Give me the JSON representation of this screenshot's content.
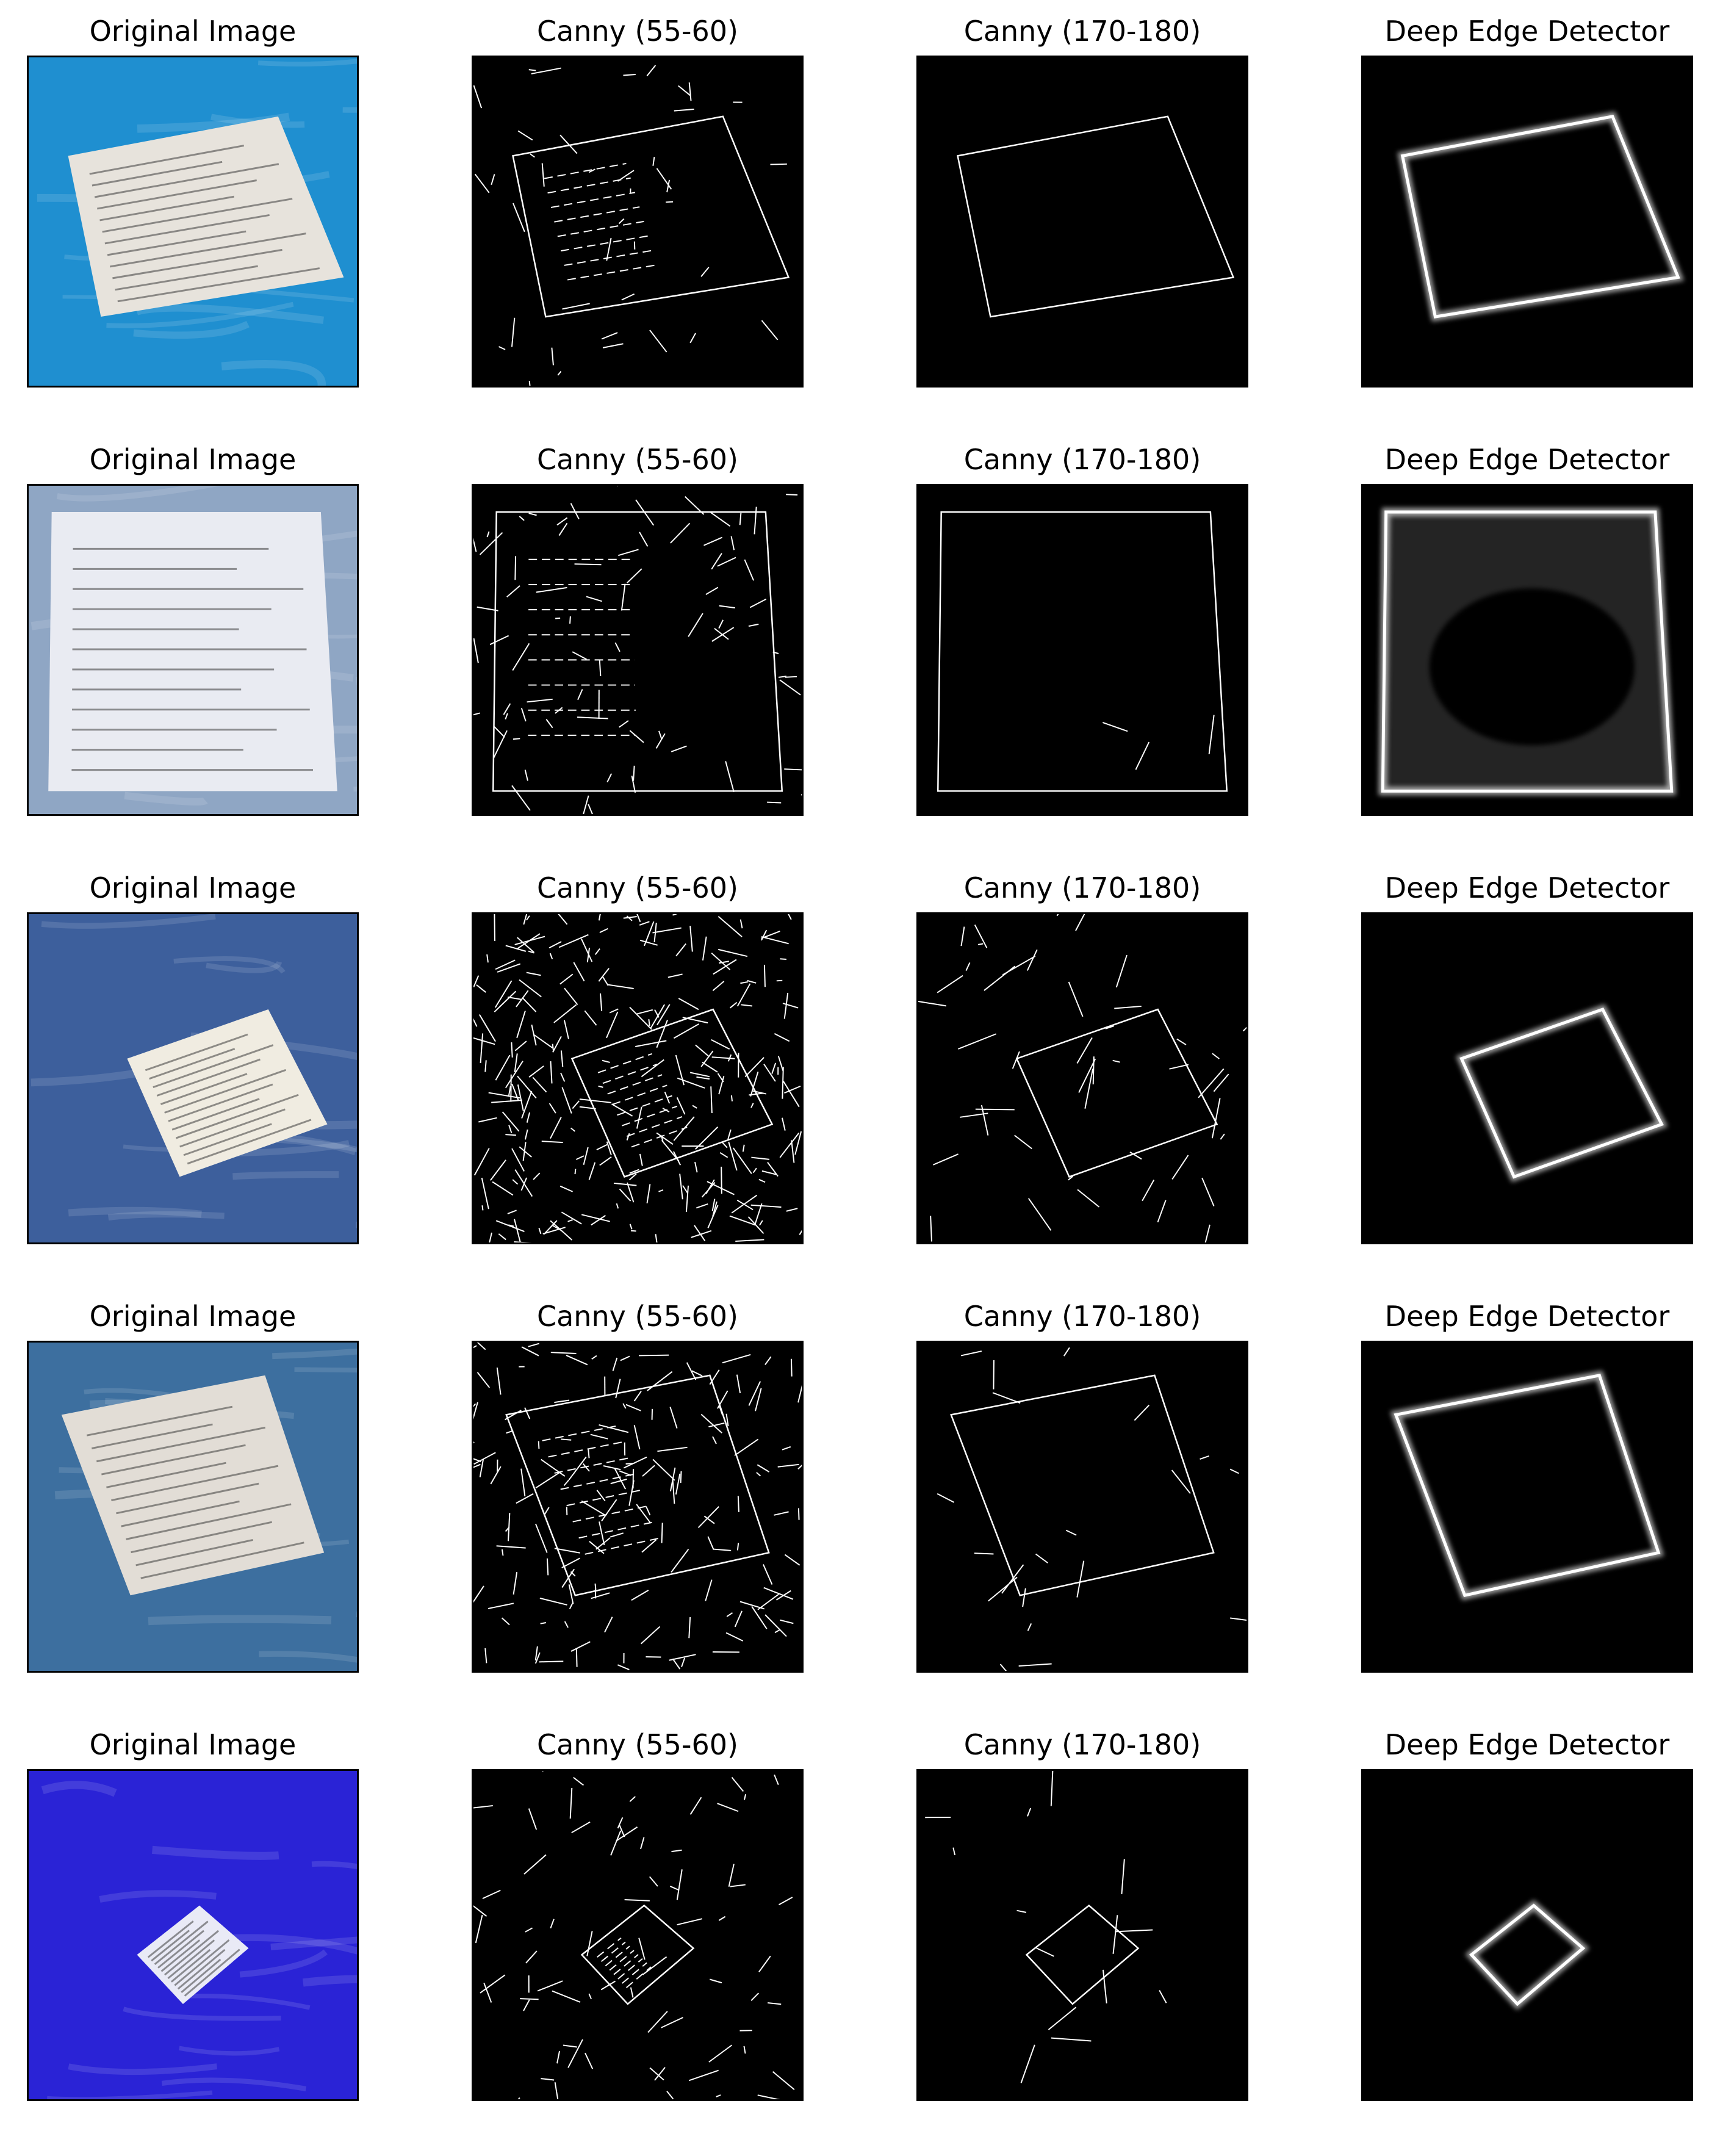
{
  "columns": [
    "Original Image",
    "Canny (55-60)",
    "Canny (170-180)",
    "Deep Edge Detector"
  ],
  "rows": [
    {
      "label": "Original Image"
    },
    {
      "label": "Original Image"
    },
    {
      "label": "Original Image"
    },
    {
      "label": "Original Image"
    },
    {
      "label": "Original Image"
    }
  ],
  "colors": {
    "page": "#ffffff",
    "edge": "#ffffff",
    "edge_bg": "#000000",
    "text": "#000000"
  }
}
